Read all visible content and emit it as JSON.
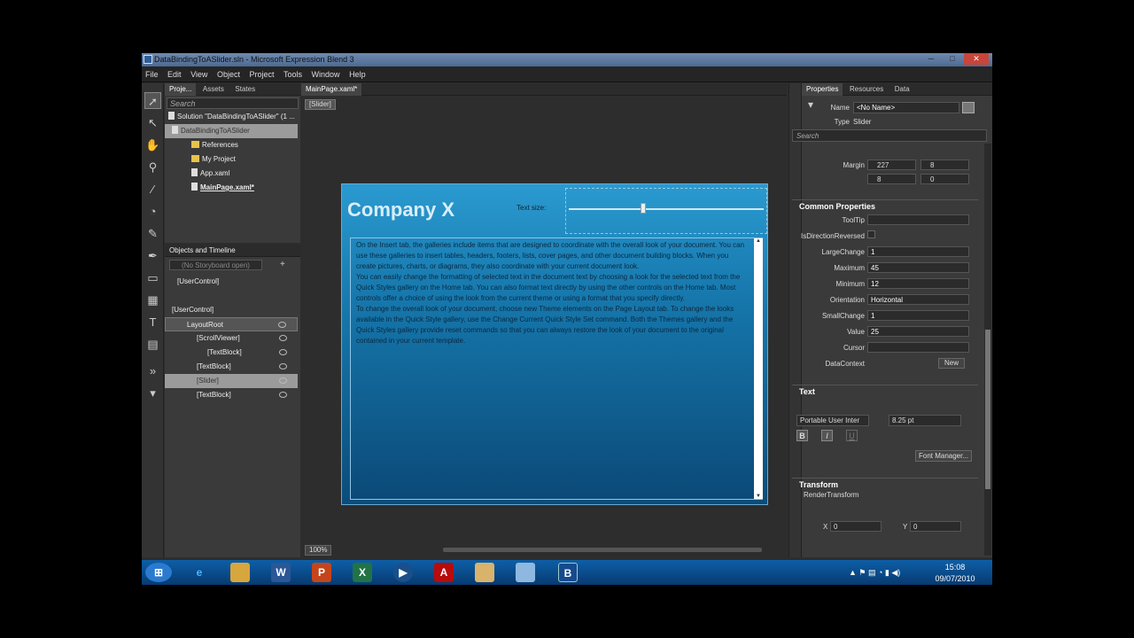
{
  "window": {
    "title": "DataBindingToASlider.sln - Microsoft Expression Blend 3",
    "minimize": "─",
    "restore": "□",
    "close": "✕"
  },
  "menu": [
    "File",
    "Edit",
    "View",
    "Object",
    "Project",
    "Tools",
    "Window",
    "Help"
  ],
  "project_panel": {
    "tabs": [
      "Proje...",
      "Assets",
      "States"
    ],
    "search_placeholder": "Search",
    "items": [
      "Solution \"DataBindingToASlider\" (1 ...",
      "DataBindingToASlider",
      "References",
      "My Project",
      "App.xaml",
      "MainPage.xaml*"
    ]
  },
  "objects_panel": {
    "title": "Objects and Timeline",
    "storyboard": "(No Storyboard open)",
    "root": "[UserControl]",
    "tree": [
      "[UserControl]",
      "LayoutRoot",
      "[ScrollViewer]",
      "[TextBlock]",
      "[TextBlock]",
      "[Slider]",
      "[TextBlock]"
    ]
  },
  "document": {
    "tab": "MainPage.xaml*",
    "breadcrumb": "[Slider]",
    "zoom": "100%",
    "heading": "Company X",
    "text_size_label": "Text size:",
    "slider_value_fraction": 0.38,
    "body": "On the Insert tab, the galleries include items that are designed to coordinate with the overall look of your document. You can use these galleries to insert tables, headers, footers, lists, cover pages, and other document building blocks. When you create pictures, charts, or diagrams, they also coordinate with your current document look.\nYou can easily change the formatting of selected text in the document text by choosing a look for the selected text from the Quick Styles gallery on the Home tab. You can also format text directly by using the other controls on the Home tab. Most controls offer a choice of using the look from the current theme or using a format that you specify directly.\nTo change the overall look of your document, choose new Theme elements on the Page Layout tab. To change the looks available in the Quick Style gallery, use the Change Current Quick Style Set command. Both the Themes gallery and the Quick Styles gallery provide reset commands so that you can always restore the look of your document to the original contained in your current template."
  },
  "properties": {
    "tabs": [
      "Properties",
      "Resources",
      "Data"
    ],
    "name_label": "Name",
    "name_value": "<No Name>",
    "type_label": "Type",
    "type_value": "Slider",
    "search_placeholder": "Search",
    "margin_label": "Margin",
    "margin": [
      "227",
      "8",
      "8",
      "0"
    ],
    "common_title": "Common Properties",
    "common": [
      {
        "label": "ToolTip",
        "value": ""
      },
      {
        "label": "IsDirectionReversed",
        "value": ""
      },
      {
        "label": "LargeChange",
        "value": "1"
      },
      {
        "label": "Maximum",
        "value": "45"
      },
      {
        "label": "Minimum",
        "value": "12"
      },
      {
        "label": "Orientation",
        "value": "Horizontal"
      },
      {
        "label": "SmallChange",
        "value": "1"
      },
      {
        "label": "Value",
        "value": "25"
      },
      {
        "label": "Cursor",
        "value": ""
      },
      {
        "label": "DataContext",
        "value": ""
      }
    ],
    "new_button": "New",
    "text_title": "Text",
    "font_family": "Portable User Inter",
    "font_size": "8.25 pt",
    "bold": "B",
    "italic": "I",
    "underline": "U",
    "font_manager": "Font Manager...",
    "transform_title": "Transform",
    "render_transform": "RenderTransform",
    "x_label": "X",
    "x_value": "0",
    "y_label": "Y",
    "y_value": "0"
  },
  "taskbar": {
    "time": "15:08",
    "date": "09/07/2010"
  }
}
